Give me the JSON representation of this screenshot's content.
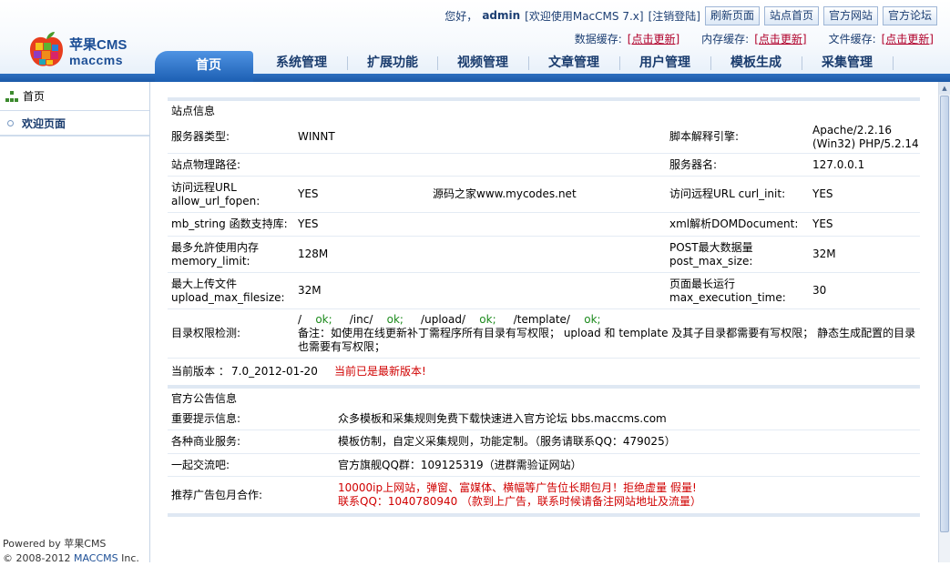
{
  "header": {
    "logo_cn": "苹果CMS",
    "logo_en": "maccms",
    "greeting": "您好，",
    "username": "admin",
    "welcome": "[欢迎使用MacCMS 7.x]",
    "logout": "[注销登陆]",
    "buttons": [
      "刷新页面",
      "站点首页",
      "官方网站",
      "官方论坛"
    ],
    "cache": [
      {
        "label": "数据缓存:",
        "link": "[点击更新]"
      },
      {
        "label": "内存缓存:",
        "link": "[点击更新]"
      },
      {
        "label": "文件缓存:",
        "link": "[点击更新]"
      }
    ]
  },
  "nav": {
    "active": "首页",
    "tabs": [
      "系统管理",
      "扩展功能",
      "视频管理",
      "文章管理",
      "用户管理",
      "模板生成",
      "采集管理"
    ]
  },
  "sidebar": {
    "home": "首页",
    "items": [
      "欢迎页面"
    ],
    "footer_line1_prefix": "Powered by ",
    "footer_line1_brand": "苹果CMS",
    "footer_line2_prefix": "© 2008-2012 ",
    "footer_line2_brand": "MACCMS",
    "footer_line2_suffix": " Inc."
  },
  "site_info": {
    "title": "站点信息",
    "rows": [
      {
        "k1": "服务器类型:",
        "v1": "WINNT",
        "k2": "脚本解释引擎:",
        "v2": "Apache/2.2.16 (Win32) PHP/5.2.14"
      },
      {
        "k1": "站点物理路径:",
        "v1": "",
        "k2": "服务器名:",
        "v2": "127.0.0.1"
      },
      {
        "k1": "访问远程URL allow_url_fopen:",
        "v1": "YES",
        "mid": "源码之家www.mycodes.net",
        "k2": "访问远程URL curl_init:",
        "v2": "YES"
      },
      {
        "k1": "mb_string 函数支持库:",
        "v1": "YES",
        "k2": "xml解析DOMDocument:",
        "v2": "YES"
      },
      {
        "k1": "最多允許使用内存 memory_limit:",
        "v1": "128M",
        "k2": "POST最大数据量 post_max_size:",
        "v2": "32M"
      },
      {
        "k1": "最大上传文件 upload_max_filesize:",
        "v1": "32M",
        "k2": "页面最长运行 max_execution_time:",
        "v2": "30"
      }
    ],
    "perm_label": "目录权限检测:",
    "perm_dirs": [
      {
        "dir": "/",
        "status": "ok;"
      },
      {
        "dir": "/inc/",
        "status": "ok;"
      },
      {
        "dir": "/upload/",
        "status": "ok;"
      },
      {
        "dir": "/template/",
        "status": "ok;"
      }
    ],
    "perm_note": "备注：如使用在线更新补丁需程序所有目录有写权限； upload 和 template 及其子目录都需要有写权限； 静态生成配置的目录也需要有写权限；",
    "version_label": "当前版本 ：",
    "version": "7.0_2012-01-20",
    "version_status": "当前已是最新版本!"
  },
  "announce": {
    "title": "官方公告信息",
    "rows": [
      {
        "k": "重要提示信息:",
        "v": "众多模板和采集规则免费下载快速进入官方论坛  bbs.maccms.com"
      },
      {
        "k": "各种商业服务:",
        "v": "模板仿制，自定义采集规则，功能定制。（服务请联系QQ：479025）"
      },
      {
        "k": "一起交流吧:",
        "v": "官方旗舰QQ群：109125319（进群需验证网站）"
      }
    ],
    "ad_label": "推荐广告包月合作:",
    "ad_line1": "10000ip上网站，弹窗、富媒体、横幅等广告位长期包月！拒绝虚量  假量!",
    "ad_line2": "联系QQ：1040780940  （款到上广告，联系时候请备注网站地址及流量）"
  },
  "colors": {
    "brand_blue": "#1d4f96",
    "nav_blue": "#1c5fb3",
    "alert_red": "#d00000",
    "ok_green": "#1c8a1c"
  }
}
